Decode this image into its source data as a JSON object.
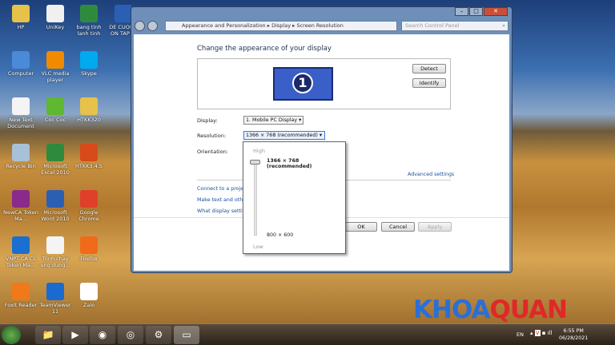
{
  "desktop": {
    "icons": [
      {
        "label": "HP",
        "color": "#e6c24a"
      },
      {
        "label": "UniKey",
        "color": "#f0f0f0"
      },
      {
        "label": "bang tinh lanh tinh",
        "color": "#2e8b3e"
      },
      {
        "label": "DE CUONG ON TAP ...",
        "color": "#2b5fb3"
      },
      {
        "label": "Computer",
        "color": "#4a8ad8"
      },
      {
        "label": "VLC media player",
        "color": "#f08a00"
      },
      {
        "label": "Skype",
        "color": "#00a9f0"
      },
      {
        "label": "New Text Document",
        "color": "#f4f4f4"
      },
      {
        "label": "Coc Coc",
        "color": "#5fb832"
      },
      {
        "label": "HTKK320",
        "color": "#e6c24a"
      },
      {
        "label": "Recycle Bin",
        "color": "#a8c0d8"
      },
      {
        "label": "Microsoft Excel 2010",
        "color": "#2e8b3e"
      },
      {
        "label": "HTKK3.4.5",
        "color": "#d84a1a"
      },
      {
        "label": "NewCA Token Ma...",
        "color": "#8a2a8a"
      },
      {
        "label": "Microsoft Word 2010",
        "color": "#2b5fb3"
      },
      {
        "label": "Google Chrome",
        "color": "#e0402a"
      },
      {
        "label": "VNPT-CA CL Token Ma...",
        "color": "#1a6fd0"
      },
      {
        "label": "Trinh chay ung dung...",
        "color": "#f4f4f4"
      },
      {
        "label": "Firefox",
        "color": "#f06a1a"
      },
      {
        "label": "Foxit Reader",
        "color": "#f07a1a"
      },
      {
        "label": "TeamViewer 11",
        "color": "#1a6ad0"
      },
      {
        "label": "Zalo",
        "color": "#ffffff"
      }
    ]
  },
  "window": {
    "breadcrumb": [
      "Appearance and Personalization",
      "Display",
      "Screen Resolution"
    ],
    "search_placeholder": "Search Control Panel",
    "heading": "Change the appearance of your display",
    "monitor_number": "1",
    "detect": "Detect",
    "identify": "Identify",
    "display_label": "Display:",
    "display_value": "1. Mobile PC Display",
    "resolution_label": "Resolution:",
    "resolution_value": "1366 × 768 (recommended)",
    "orientation_label": "Orientation:",
    "advanced": "Advanced settings",
    "links": [
      "Connect to a projec",
      "Make text and other",
      "What display setting"
    ],
    "ok": "OK",
    "cancel": "Cancel",
    "apply": "Apply"
  },
  "popup": {
    "high": "High",
    "low": "Low",
    "top_option": "1366 × 768 (recommended)",
    "bottom_option": "800 × 600",
    "slider_level": 1.0
  },
  "watermark": {
    "part1": "KHOA",
    "part2": "QUAN",
    "color1": "#2a6fd8",
    "color2": "#e02828"
  },
  "taskbar": {
    "items": [
      "start-orb",
      "explorer",
      "media-player",
      "chrome",
      "coccoc",
      "control-panel",
      "display"
    ],
    "lang": "EN",
    "time": "6:55 PM",
    "date": "06/28/2021"
  }
}
